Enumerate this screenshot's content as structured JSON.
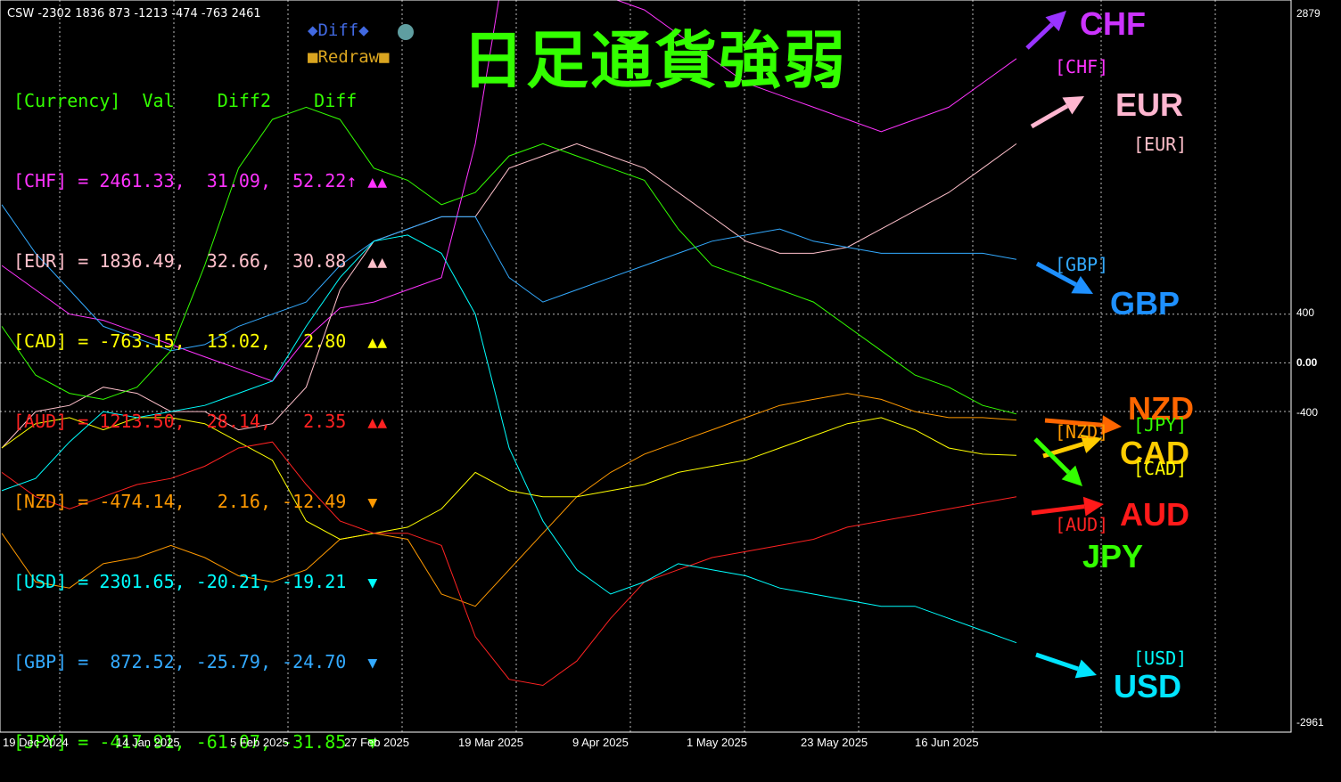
{
  "indicator_label": "CSW -2302 1836 873 -1213 -474 -763 2461",
  "title": "日足通貨強弱",
  "panel": {
    "header": "[Currency]  Val    Diff2    Diff",
    "rows": [
      {
        "label": "[CHF] = 2461.33,  31.09,  52.22↑",
        "tri": "▲▲",
        "color": "#ff33ff",
        "tri_color": "#ff33ff"
      },
      {
        "label": "[EUR] = 1836.49,  32.66,  30.88",
        "tri": "▲▲",
        "color": "#ffc0cb",
        "tri_color": "#ffc0cb"
      },
      {
        "label": "[CAD] = -763.15,  13.02,   2.80",
        "tri": "▲▲",
        "color": "#ffff00",
        "tri_color": "#ffff00"
      },
      {
        "label": "[AUD] = 1213.50,  28.14,   2.35",
        "tri": "▲▲",
        "color": "#ff2222",
        "tri_color": "#ff2222"
      },
      {
        "label": "[NZD] = -474.14,   2.16, -12.49",
        "tri": "▼",
        "color": "#ff9900",
        "tri_color": "#ff9900"
      },
      {
        "label": "[USD] = 2301.65, -20.21, -19.21",
        "tri": "▼",
        "color": "#00ffff",
        "tri_color": "#00ffff"
      },
      {
        "label": "[GBP] =  872.52, -25.79, -24.70",
        "tri": "▼",
        "color": "#33aaff",
        "tri_color": "#33aaff"
      },
      {
        "label": "[JPY] = -417.91, -61.07, -31.85",
        "tri": "▼",
        "color": "#33ff00",
        "tri_color": "#33ff00"
      }
    ]
  },
  "buttons": {
    "diff": "◆Diff◆",
    "redraw": "■Redraw■"
  },
  "right_labels": {
    "chf": "CHF",
    "eur": "EUR",
    "gbp": "GBP",
    "nzd": "NZD",
    "cad": "CAD",
    "aud": "AUD",
    "jpy": "JPY",
    "usd": "USD"
  },
  "bracket_labels": {
    "chf": "[CHF]",
    "eur": "[EUR]",
    "gbp": "[GBP]",
    "jpy": "[JPY]",
    "nzd": "[NZD]",
    "cad": "[CAD]",
    "aud": "[AUD]",
    "usd": "[USD]"
  },
  "chart_data": {
    "type": "line",
    "x": [
      "2024-12-19",
      "2024-12-27",
      "2025-01-06",
      "2025-01-14",
      "2025-01-23",
      "2025-01-31",
      "2025-02-05",
      "2025-02-14",
      "2025-02-21",
      "2025-02-27",
      "2025-03-07",
      "2025-03-13",
      "2025-03-19",
      "2025-03-27",
      "2025-04-03",
      "2025-04-09",
      "2025-04-15",
      "2025-04-21",
      "2025-04-25",
      "2025-05-01",
      "2025-05-08",
      "2025-05-14",
      "2025-05-20",
      "2025-05-23",
      "2025-05-30",
      "2025-06-05",
      "2025-06-11",
      "2025-06-16",
      "2025-06-20",
      "2025-06-26",
      "2025-07-01"
    ],
    "x_ticks": [
      "19 Dec 2024",
      "14 Jan 2025",
      "5 Feb 2025",
      "27 Feb 2025",
      "19 Mar 2025",
      "9 Apr 2025",
      "1 May 2025",
      "23 May 2025",
      "16 Jun 2025"
    ],
    "y_ticks": [
      "2879",
      "400",
      "0.00",
      "-400",
      "-2961"
    ],
    "ylim": [
      -2961,
      2879
    ],
    "series": [
      {
        "name": "CHF",
        "color": "#ff33ff",
        "values": [
          800,
          600,
          400,
          350,
          250,
          150,
          50,
          -50,
          -150,
          200,
          450,
          500,
          600,
          700,
          1800,
          3500,
          3600,
          3300,
          3000,
          2900,
          2700,
          2500,
          2300,
          2200,
          2100,
          2000,
          1900,
          2000,
          2100,
          2300,
          2500
        ]
      },
      {
        "name": "EUR",
        "color": "#ffc0cb",
        "values": [
          -700,
          -400,
          -350,
          -200,
          -250,
          -400,
          -400,
          -550,
          -500,
          -200,
          600,
          1000,
          1100,
          1200,
          1200,
          1600,
          1700,
          1800,
          1700,
          1600,
          1400,
          1200,
          1000,
          900,
          900,
          950,
          1100,
          1250,
          1400,
          1600,
          1800
        ]
      },
      {
        "name": "GBP",
        "color": "#33aaff",
        "values": [
          1300,
          900,
          600,
          300,
          200,
          100,
          150,
          300,
          400,
          500,
          800,
          1000,
          1100,
          1200,
          1200,
          700,
          500,
          600,
          700,
          800,
          900,
          1000,
          1050,
          1100,
          1000,
          950,
          900,
          900,
          900,
          900,
          850
        ]
      },
      {
        "name": "JPY",
        "color": "#33ff00",
        "values": [
          300,
          -100,
          -250,
          -300,
          -200,
          100,
          800,
          1600,
          2000,
          2100,
          2000,
          1600,
          1500,
          1300,
          1400,
          1700,
          1800,
          1700,
          1600,
          1500,
          1100,
          800,
          700,
          600,
          500,
          300,
          100,
          -100,
          -200,
          -350,
          -420
        ]
      },
      {
        "name": "NZD",
        "color": "#ff9900",
        "values": [
          -1400,
          -1800,
          -1850,
          -1650,
          -1600,
          -1500,
          -1600,
          -1750,
          -1800,
          -1700,
          -1450,
          -1400,
          -1450,
          -1900,
          -2000,
          -1700,
          -1400,
          -1100,
          -900,
          -750,
          -650,
          -550,
          -450,
          -350,
          -300,
          -250,
          -300,
          -400,
          -450,
          -450,
          -470
        ]
      },
      {
        "name": "CAD",
        "color": "#ffff00",
        "values": [
          -700,
          -500,
          -450,
          -550,
          -450,
          -450,
          -500,
          -650,
          -800,
          -1300,
          -1450,
          -1400,
          -1350,
          -1200,
          -900,
          -1050,
          -1100,
          -1100,
          -1050,
          -1000,
          -900,
          -850,
          -800,
          -700,
          -600,
          -500,
          -450,
          -550,
          -700,
          -750,
          -760
        ]
      },
      {
        "name": "AUD",
        "color": "#ff2222",
        "values": [
          -900,
          -1100,
          -1200,
          -1100,
          -1000,
          -950,
          -850,
          -700,
          -650,
          -1000,
          -1300,
          -1400,
          -1400,
          -1500,
          -2250,
          -2600,
          -2650,
          -2450,
          -2100,
          -1800,
          -1700,
          -1600,
          -1550,
          -1500,
          -1450,
          -1350,
          -1300,
          -1250,
          -1200,
          -1150,
          -1100
        ]
      },
      {
        "name": "USD",
        "color": "#00ffff",
        "values": [
          -1050,
          -950,
          -650,
          -400,
          -450,
          -400,
          -350,
          -250,
          -150,
          300,
          700,
          1000,
          1050,
          900,
          400,
          -700,
          -1300,
          -1700,
          -1900,
          -1800,
          -1650,
          -1700,
          -1750,
          -1850,
          -1900,
          -1950,
          -2000,
          -2000,
          -2100,
          -2200,
          -2300
        ]
      }
    ]
  }
}
